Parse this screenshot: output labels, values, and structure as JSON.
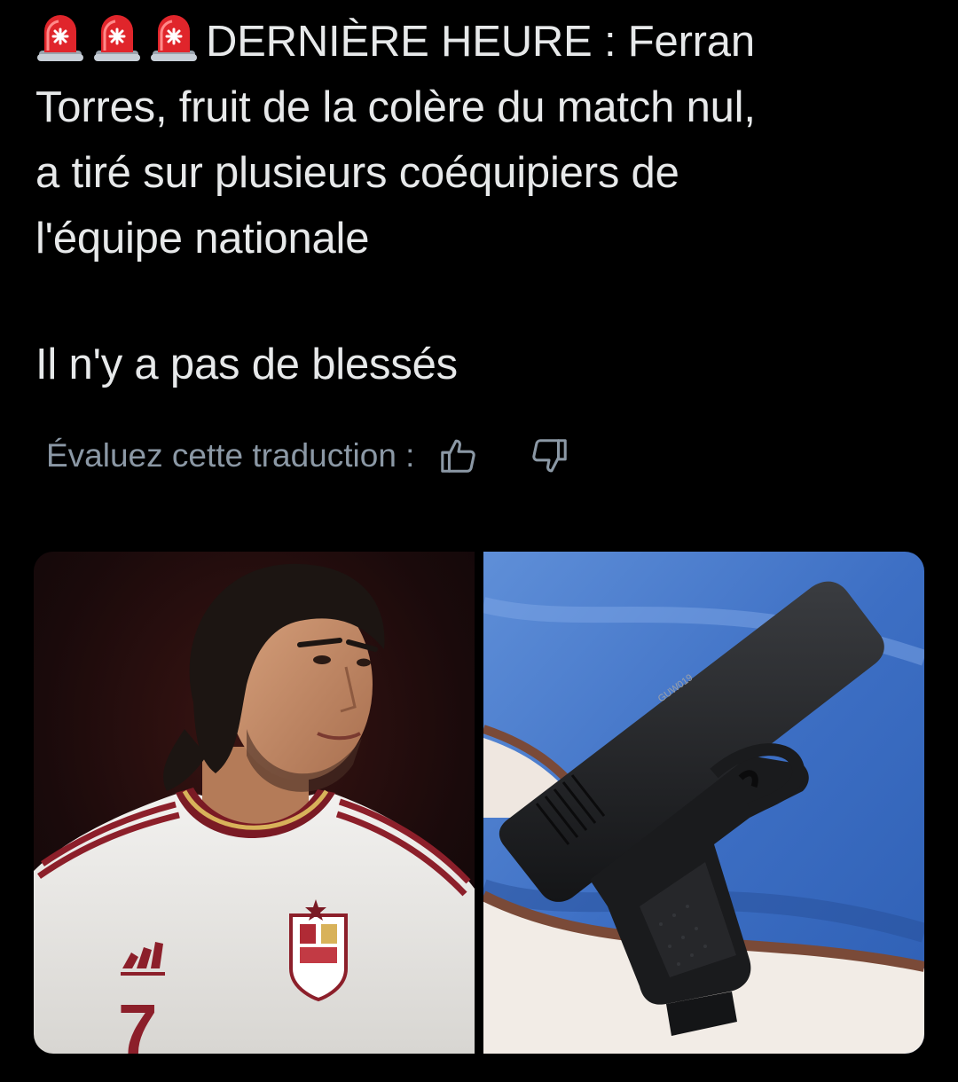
{
  "tweet": {
    "icons": [
      "police-light-icon",
      "police-light-icon",
      "police-light-icon"
    ],
    "lines": [
      "DERNIÈRE HEURE : Ferran",
      "Torres, fruit de la colère du match nul,",
      "a tiré sur plusieurs coéquipiers de",
      "l'équipe nationale"
    ],
    "second_paragraph": "Il n'y a pas de blessés"
  },
  "translation_rating": {
    "label": "Évaluez cette traduction :",
    "thumbs_up_icon": "thumbs-up-icon",
    "thumbs_down_icon": "thumbs-down-icon"
  },
  "media": {
    "items": [
      {
        "kind": "photo-football-player",
        "jersey_number": "7"
      },
      {
        "kind": "photo-pistol",
        "engraving": "GUW019"
      }
    ]
  },
  "colors": {
    "background": "#000000",
    "text": "#e7e9ea",
    "muted": "#8b98a5",
    "siren": "#e0252b"
  }
}
